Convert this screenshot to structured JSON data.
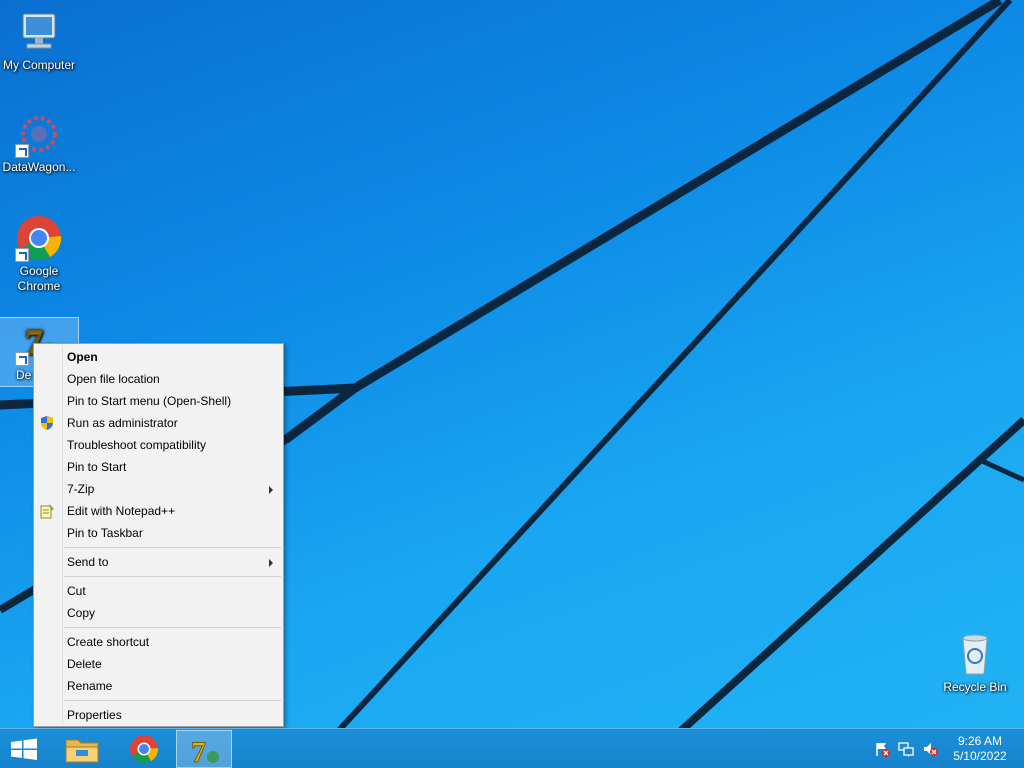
{
  "desktop": {
    "icons": [
      {
        "label": "My Computer"
      },
      {
        "label": "DataWagon..."
      },
      {
        "label": "Google Chrome"
      },
      {
        "label": "De"
      },
      {
        "label": "Recycle Bin"
      }
    ]
  },
  "context_menu": {
    "items": [
      {
        "label": "Open",
        "bold": true
      },
      {
        "label": "Open file location"
      },
      {
        "label": "Pin to Start menu (Open-Shell)"
      },
      {
        "label": "Run as administrator",
        "icon": "uac-shield-icon"
      },
      {
        "label": "Troubleshoot compatibility"
      },
      {
        "label": "Pin to Start"
      },
      {
        "label": "7-Zip",
        "submenu": true
      },
      {
        "label": "Edit with Notepad++",
        "icon": "notepad-plus-plus-icon"
      },
      {
        "label": "Pin to Taskbar"
      },
      {
        "label": "Send to",
        "submenu": true
      },
      {
        "label": "Cut"
      },
      {
        "label": "Copy"
      },
      {
        "label": "Create shortcut"
      },
      {
        "label": "Delete"
      },
      {
        "label": "Rename"
      },
      {
        "label": "Properties"
      }
    ]
  },
  "taskbar": {
    "buttons": [
      "start-button-icon",
      "file-explorer-icon",
      "chrome-icon",
      "7zip-icon"
    ],
    "tray_icons": [
      "action-center-flag-icon",
      "network-icon",
      "volume-muted-icon"
    ],
    "clock_time": "9:26 AM",
    "clock_date": "5/10/2022"
  },
  "colors": {
    "desktop_blue": "#0d8be6",
    "taskbar": "#1683cc",
    "menu_background": "#f2f2f2"
  }
}
